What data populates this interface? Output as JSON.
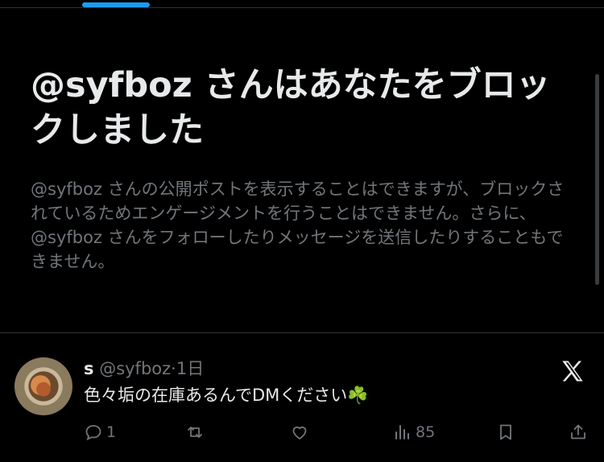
{
  "block_notice": {
    "title": "@syfboz さんはあなたをブロックしました",
    "description": "@syfboz さんの公開ポストを表示することはできますが、ブロックされているためエンゲージメントを行うことはできません。さらに、@syfboz さんをフォローしたりメッセージを送信したりすることもできません。"
  },
  "tweet": {
    "display_name": "s",
    "handle": "@syfboz",
    "separator": "·",
    "time": "1日",
    "text": "色々垢の在庫あるんでDMください☘️",
    "reply_count": "1",
    "views_count": "85"
  },
  "icons": {
    "reply": "reply-icon",
    "retweet": "retweet-icon",
    "like": "heart-icon",
    "views": "views-icon",
    "bookmark": "bookmark-icon",
    "share": "share-icon",
    "brand": "x-logo-icon"
  },
  "colors": {
    "background": "#000000",
    "primary_text": "#e7e9ea",
    "secondary_text": "#71767b",
    "accent": "#1d9bf0"
  }
}
